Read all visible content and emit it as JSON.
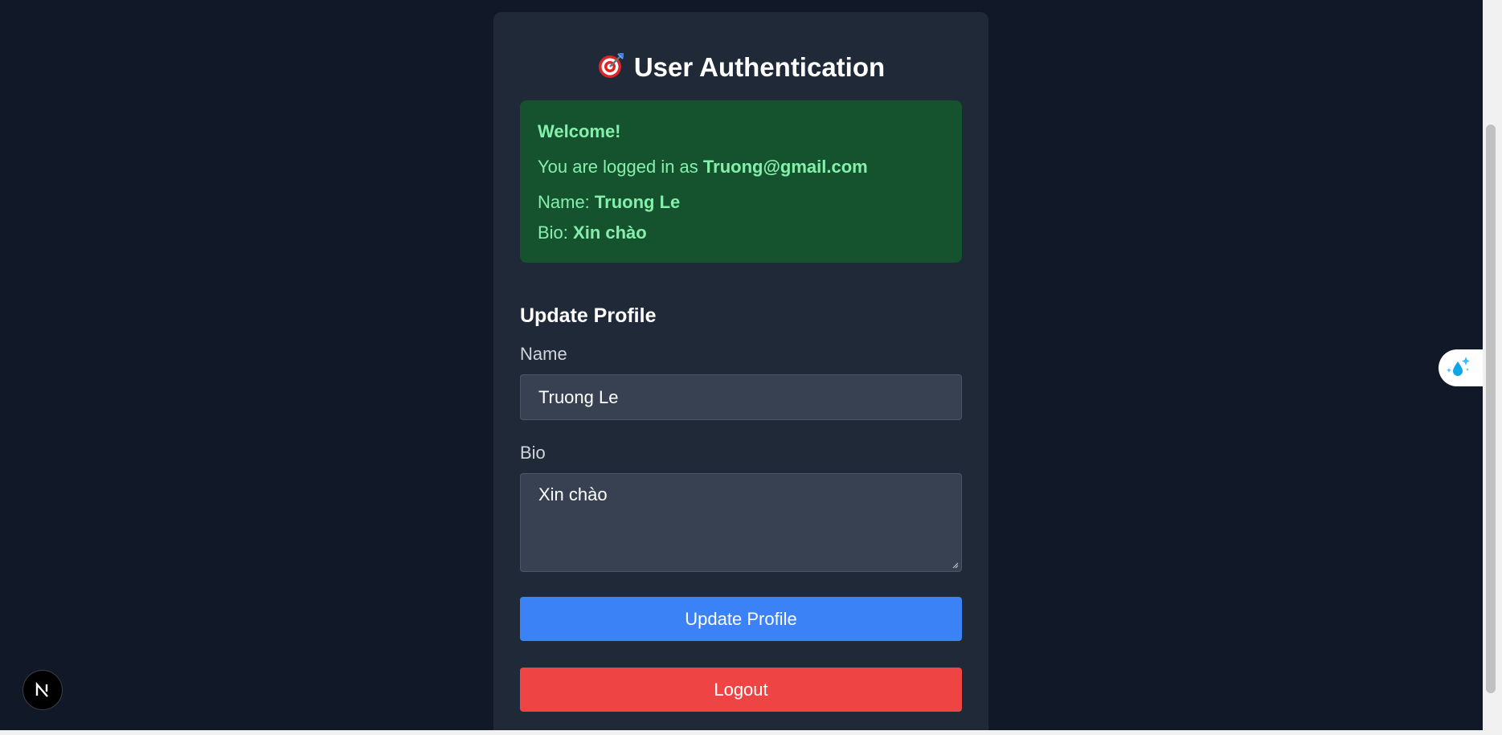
{
  "header": {
    "title": "User Authentication",
    "icon": "target-icon"
  },
  "welcome": {
    "heading": "Welcome!",
    "logged_in_prefix": "You are logged in as ",
    "email": "Truong@gmail.com",
    "name_prefix": "Name: ",
    "name": "Truong Le",
    "bio_prefix": "Bio: ",
    "bio": "Xin chào"
  },
  "form": {
    "section_title": "Update Profile",
    "name_label": "Name",
    "name_value": "Truong Le",
    "bio_label": "Bio",
    "bio_value": "Xin chào",
    "update_button": "Update Profile",
    "logout_button": "Logout"
  },
  "colors": {
    "background": "#111827",
    "card": "#1f2937",
    "welcome_bg": "#14532d",
    "welcome_text": "#86efac",
    "input_bg": "#374151",
    "update_button": "#3b82f6",
    "logout_button": "#ef4444"
  },
  "overlays": {
    "next_badge_icon": "nextjs-logo-icon",
    "side_widget_icon": "water-drop-sparkle-icon"
  }
}
